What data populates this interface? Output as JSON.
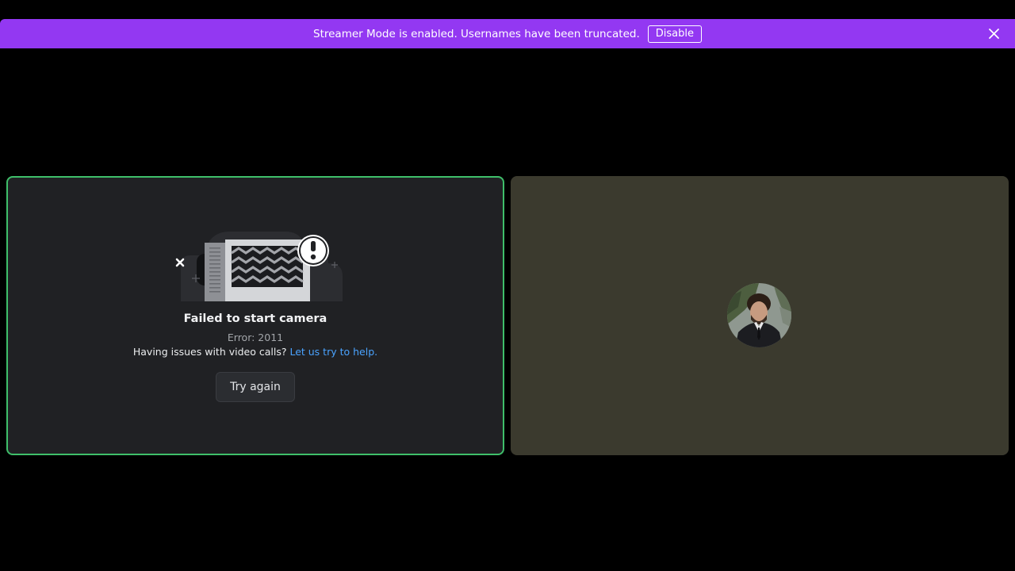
{
  "banner": {
    "message": "Streamer Mode is enabled. Usernames have been truncated.",
    "disable_label": "Disable",
    "close_icon": "close-icon",
    "background": "#9338f2"
  },
  "camera_tile": {
    "title": "Failed to start camera",
    "error_code": "Error: 2011",
    "help_text": "Having issues with video calls?",
    "help_link": "Let us try to help.",
    "retry_label": "Try again",
    "illustration_icon": "broken-camera-illustration",
    "border_color": "#3fbf6a"
  },
  "participant_tile": {
    "avatar_icon": "user-avatar",
    "background": "#3b3a2e"
  }
}
